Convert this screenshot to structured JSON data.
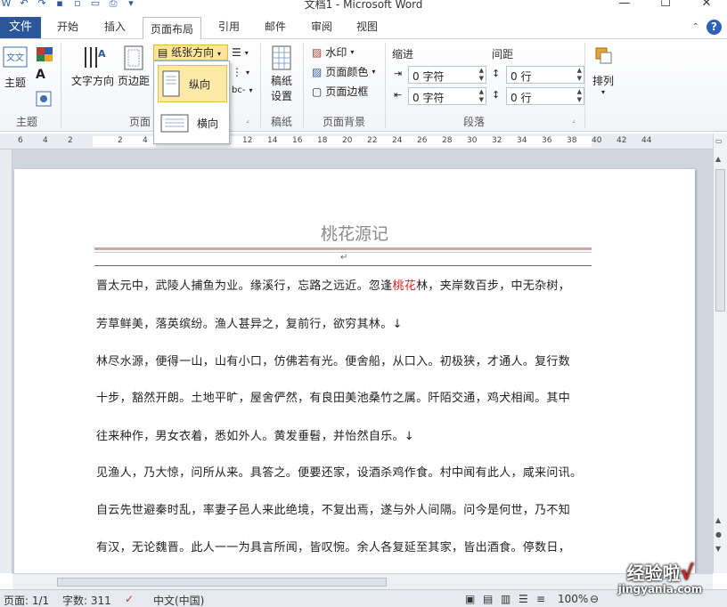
{
  "window": {
    "title": "文档1 - Microsoft Word"
  },
  "tabs": {
    "file": "文件",
    "items": [
      "开始",
      "插入",
      "页面布局",
      "引用",
      "邮件",
      "审阅",
      "视图"
    ],
    "active": "页面布局"
  },
  "ribbon": {
    "theme": {
      "btn": "主题",
      "group": "主题"
    },
    "page_setup": {
      "text_direction": "文字方向",
      "margins": "页边距",
      "orientation": "纸张方向",
      "group": "页面"
    },
    "orientation_menu": {
      "portrait": "纵向",
      "landscape": "横向"
    },
    "manuscript": {
      "btn_line1": "稿纸",
      "btn_line2": "设置",
      "group": "稿纸"
    },
    "background": {
      "watermark": "水印",
      "page_color": "页面颜色",
      "page_border": "页面边框",
      "group": "页面背景"
    },
    "paragraph": {
      "indent": "缩进",
      "spacing": "间距",
      "indent_left": "0 字符",
      "indent_right": "0 字符",
      "space_before": "0 行",
      "space_after": "0 行",
      "group": "段落"
    },
    "arrange": {
      "btn": "排列"
    }
  },
  "ruler": {
    "numbers": [
      "6",
      "4",
      "2",
      "2",
      "4",
      "6",
      "8",
      "10",
      "12",
      "14",
      "16",
      "18",
      "20",
      "22",
      "24",
      "26",
      "28",
      "30",
      "32",
      "34",
      "36",
      "38",
      "40",
      "42",
      "44"
    ]
  },
  "document": {
    "title": "桃花源记",
    "lines": [
      {
        "pre": "晋太元中，武陵人捕鱼为业。缘溪行，忘路之远近。忽逢",
        "hl": "桃花",
        "post": "林，夹岸数百步，中无杂树，"
      },
      {
        "pre": "芳草鲜美，落英缤纷。渔人甚异之，复前行，欲穷其林。↓",
        "hl": "",
        "post": ""
      },
      {
        "pre": "林尽水源，便得一山，山有小口，仿佛若有光。便舍船，从口入。初极狭，才通人。复行数",
        "hl": "",
        "post": ""
      },
      {
        "pre": "十步，豁然开朗。土地平旷，屋舍俨然，有良田美池桑竹之属。阡陌交通，鸡犬相闻。其中",
        "hl": "",
        "post": ""
      },
      {
        "pre": "往来种作，男女衣着，悉如外人。黄发垂髫，并怡然自乐。↓",
        "hl": "",
        "post": ""
      },
      {
        "pre": "见渔人，乃大惊，问所从来。具答之。便要还家，设酒杀鸡作食。村中闻有此人，咸来问讯。",
        "hl": "",
        "post": ""
      },
      {
        "pre": "自云先世避秦时乱，率妻子邑人来此绝境，不复出焉，遂与外人间隔。问今是何世，乃不知",
        "hl": "",
        "post": ""
      },
      {
        "pre": "有汉，无论魏晋。此人一一为具言所闻，皆叹惋。余人各复延至其家，皆出酒食。停数日，",
        "hl": "",
        "post": ""
      }
    ]
  },
  "status": {
    "page": "页面: 1/1",
    "words": "字数: 311",
    "language": "中文(中国)",
    "zoom": "100%"
  },
  "watermark": {
    "line1": "经验啦",
    "line2": "jingyanla.com"
  },
  "colors": {
    "file_tab": "#2b579a",
    "highlight": "#e02020",
    "selected": "#fde9a8"
  }
}
